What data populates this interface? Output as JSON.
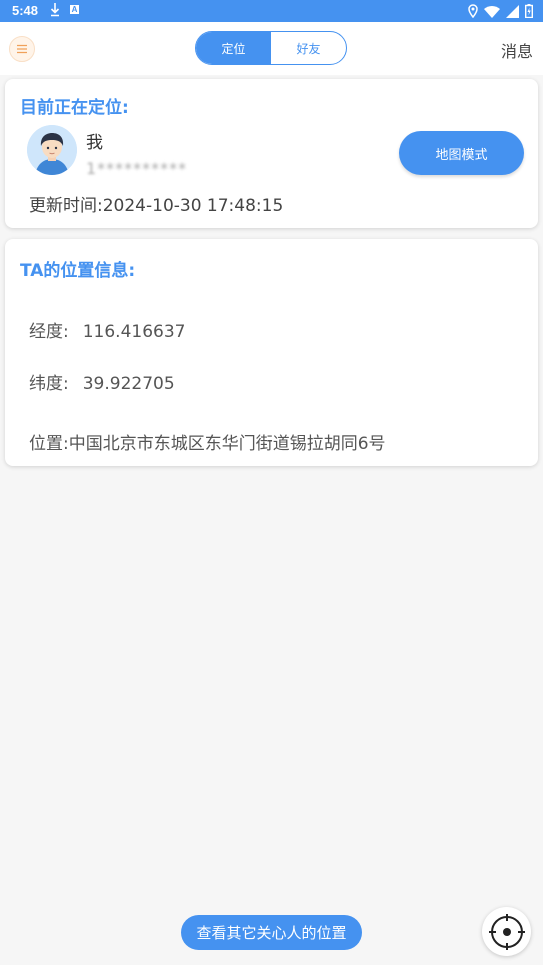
{
  "status_bar": {
    "time": "5:48",
    "icons": [
      "download-icon",
      "a-notification-icon",
      "location-icon",
      "wifi-icon",
      "signal-icon",
      "battery-icon"
    ]
  },
  "header": {
    "tabs": [
      {
        "label": "定位",
        "active": true
      },
      {
        "label": "好友",
        "active": false
      }
    ],
    "messages_label": "消息"
  },
  "current_card": {
    "title": "目前正在定位:",
    "user_name": "我",
    "phone": "1**********",
    "map_button_label": "地图模式",
    "update_time": "更新时间:2024-10-30 17:48:15"
  },
  "ta_card": {
    "title": "TA的位置信息:",
    "longitude_label": "经度:",
    "longitude_value": "116.416637",
    "latitude_label": "纬度:",
    "latitude_value": "39.922705",
    "address": "位置:中国北京市东城区东华门街道锡拉胡同6号"
  },
  "footer": {
    "others_button_label": "查看其它关心人的位置"
  },
  "colors": {
    "accent": "#4592f0",
    "background": "#f6f6f6"
  }
}
